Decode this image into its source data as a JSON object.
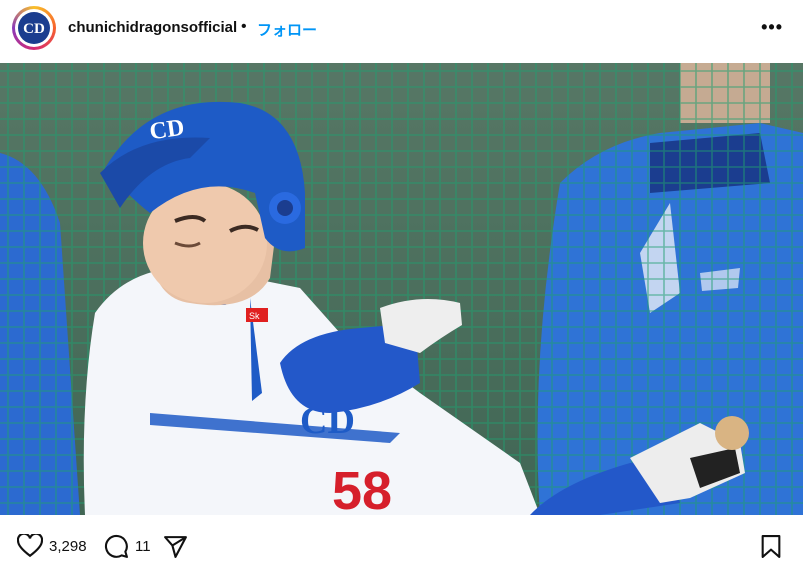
{
  "header": {
    "username": "chunichidragonsofficial",
    "separator": "•",
    "follow_label": "フォロー",
    "more_label": "•••",
    "avatar_logo": "CD"
  },
  "photo": {
    "helmet_logo": "CD",
    "sleeve_logo": "CD",
    "uniform_number": "58",
    "patch_text": "Sk"
  },
  "actions": {
    "like_count": "3,298",
    "comment_count": "11"
  },
  "colors": {
    "accent": "#0095f6",
    "dragons_blue": "#1e5bc6"
  },
  "icons": [
    "heart-icon",
    "comment-icon",
    "share-icon",
    "bookmark-icon",
    "more-icon"
  ]
}
